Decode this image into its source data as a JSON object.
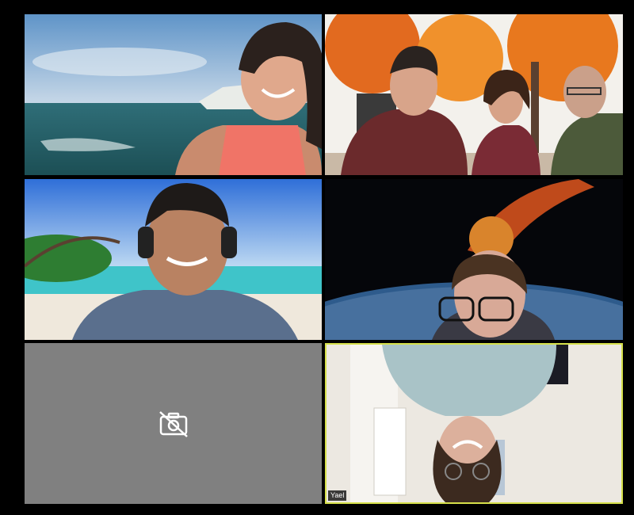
{
  "participants": [
    {
      "background": "ocean-cliff",
      "camera": "on"
    },
    {
      "background": "autumn-trees",
      "camera": "on"
    },
    {
      "background": "tropical-beach",
      "camera": "on"
    },
    {
      "background": "meteor-earth",
      "camera": "on"
    },
    {
      "background": "none",
      "camera": "off",
      "icon": "camera-off-icon"
    },
    {
      "background": "room",
      "camera": "on",
      "name": "Yael",
      "active_speaker": true
    }
  ],
  "colors": {
    "window_bg": "#000000",
    "camera_off_tile": "#808080",
    "active_speaker_border": "#d6e04a"
  }
}
